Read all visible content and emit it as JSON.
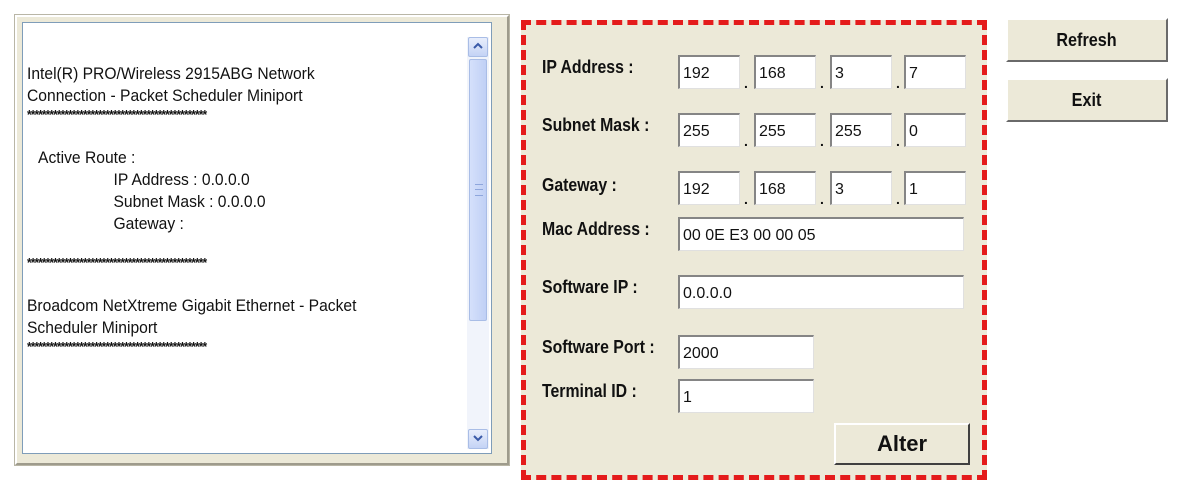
{
  "output": {
    "lines": [
      {
        "text": "Intel(R) PRO/Wireless 2915ABG Network",
        "style": "bold"
      },
      {
        "text": "Connection - Packet Scheduler Miniport",
        "style": "bold"
      },
      {
        "text": "************************************************",
        "style": "stars"
      },
      {
        "text": "",
        "style": "gap"
      },
      {
        "text": "Active Route :",
        "style": "indent1"
      },
      {
        "text": "IP Address : 0.0.0.0",
        "style": "indent2"
      },
      {
        "text": "Subnet Mask : 0.0.0.0",
        "style": "indent2"
      },
      {
        "text": "Gateway :",
        "style": "indent2"
      },
      {
        "text": "",
        "style": "gap"
      },
      {
        "text": "************************************************",
        "style": "stars"
      },
      {
        "text": "",
        "style": "gap"
      },
      {
        "text": "Broadcom NetXtreme Gigabit Ethernet - Packet",
        "style": "bold"
      },
      {
        "text": "Scheduler Miniport",
        "style": "bold"
      },
      {
        "text": "************************************************",
        "style": "stars"
      }
    ]
  },
  "config": {
    "ip_label": "IP Address :",
    "ip": [
      "192",
      "168",
      "3",
      "7"
    ],
    "subnet_label": "Subnet Mask :",
    "subnet": [
      "255",
      "255",
      "255",
      "0"
    ],
    "gateway_label": "Gateway :",
    "gateway": [
      "192",
      "168",
      "3",
      "1"
    ],
    "mac_label": "Mac Address :",
    "mac": "00 0E E3 00 00 05",
    "software_ip_label": "Software IP :",
    "software_ip": "0.0.0.0",
    "software_port_label": "Software Port :",
    "software_port": "2000",
    "terminal_id_label": "Terminal ID :",
    "terminal_id": "1",
    "alter_label": "Alter",
    "dot": "."
  },
  "actions": {
    "refresh_label": "Refresh",
    "exit_label": "Exit"
  },
  "icons": {
    "scroll_up": "chevron-up-icon",
    "scroll_down": "chevron-down-icon"
  },
  "colors": {
    "highlight_border": "#e41b1b",
    "panel_bg": "#ece9d8"
  }
}
